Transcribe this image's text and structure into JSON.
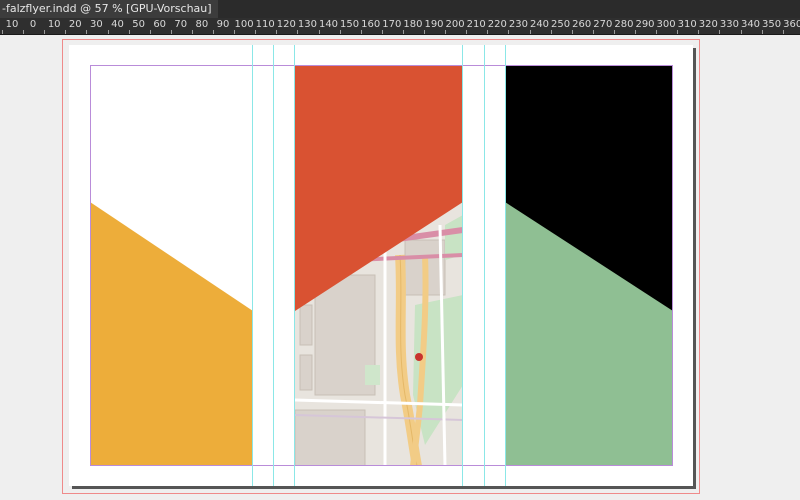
{
  "document_tab": {
    "title": "-falzflyer.indd @ 57 % [GPU-Vorschau]"
  },
  "ruler": {
    "labels": [
      "10",
      "0",
      "10",
      "20",
      "30",
      "40",
      "50",
      "60",
      "70",
      "80",
      "90",
      "100",
      "110",
      "120",
      "130",
      "140",
      "150",
      "160",
      "170",
      "180",
      "190",
      "200",
      "210",
      "220",
      "230",
      "240",
      "250",
      "260",
      "270",
      "280",
      "290",
      "300",
      "310",
      "320",
      "330",
      "340",
      "350",
      "360"
    ]
  },
  "colors": {
    "orange": "#EDAD3A",
    "red": "#D95232",
    "black": "#000000",
    "green": "#8FBF93",
    "guide_cyan": "#8BE7E7",
    "margin_purple": "#B98CD9",
    "bleed_red": "#EF8A8A"
  }
}
